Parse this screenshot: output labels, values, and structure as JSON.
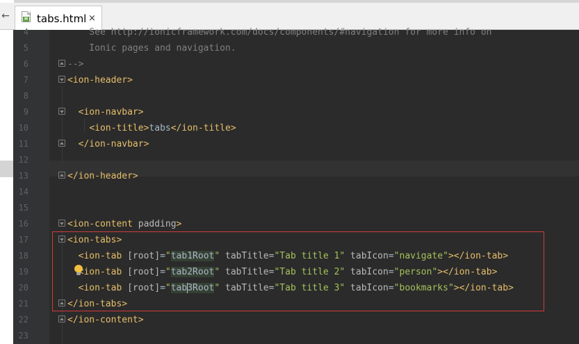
{
  "tab": {
    "file_name": "tabs.html",
    "close_glyph": "×",
    "file_type_letter": "H",
    "file_icon": "html-file-icon",
    "back_icon": "back-arrow-icon"
  },
  "lines": [
    {
      "num": "4",
      "text": "    See http://ionicframework.com/docs/components/#navigation for more info on"
    },
    {
      "num": "5",
      "text": "    Ionic pages and navigation."
    },
    {
      "num": "6",
      "text": "-->"
    },
    {
      "num": "7",
      "text": "<ion-header>"
    },
    {
      "num": "8",
      "text": ""
    },
    {
      "num": "9",
      "text": "  <ion-navbar>"
    },
    {
      "num": "10",
      "text": "    <ion-title>tabs</ion-title>"
    },
    {
      "num": "11",
      "text": "  </ion-navbar>"
    },
    {
      "num": "12",
      "text": ""
    },
    {
      "num": "13",
      "text": "</ion-header>"
    },
    {
      "num": "14",
      "text": ""
    },
    {
      "num": "15",
      "text": ""
    },
    {
      "num": "16",
      "text": "<ion-content padding>"
    },
    {
      "num": "17",
      "text": "<ion-tabs>"
    },
    {
      "num": "18",
      "text": "  <ion-tab [root]=\"tab1Root\" tabTitle=\"Tab title 1\" tabIcon=\"navigate\"></ion-tab>"
    },
    {
      "num": "19",
      "text": "  <ion-tab [root]=\"tab2Root\" tabTitle=\"Tab title 2\" tabIcon=\"person\"></ion-tab>"
    },
    {
      "num": "20",
      "text": "  <ion-tab [root]=\"tab3Root\" tabTitle=\"Tab title 3\" tabIcon=\"bookmarks\"></ion-tab>"
    },
    {
      "num": "21",
      "text": "</ion-tabs>"
    },
    {
      "num": "22",
      "text": "</ion-content>"
    },
    {
      "num": "23",
      "text": ""
    }
  ],
  "colors": {
    "editor_background": "#2b2b2b",
    "gutter_background": "#313335",
    "tag": "#e8bf6a",
    "attribute": "#bababa",
    "string": "#a5c25c",
    "comment": "#808080",
    "highlight_box": "#d23b3b"
  },
  "intention_icon": "lightbulb-icon"
}
